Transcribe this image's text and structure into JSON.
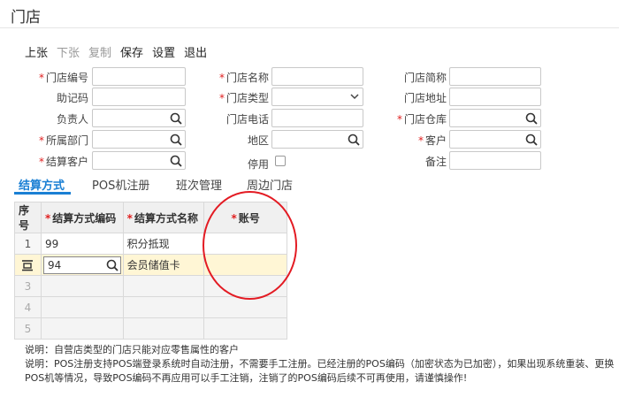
{
  "window": {
    "title": "门店"
  },
  "toolbar": {
    "items": [
      {
        "label": "上张",
        "enabled": true
      },
      {
        "label": "下张",
        "enabled": false
      },
      {
        "label": "复制",
        "enabled": false
      },
      {
        "label": "保存",
        "enabled": true
      },
      {
        "label": "设置",
        "enabled": true
      },
      {
        "label": "退出",
        "enabled": true
      }
    ]
  },
  "form": {
    "store_code": {
      "label": "门店编号",
      "required": true,
      "value": ""
    },
    "store_name": {
      "label": "门店名称",
      "required": true,
      "value": ""
    },
    "store_short": {
      "label": "门店简称",
      "required": false,
      "value": ""
    },
    "mnemonic": {
      "label": "助记码",
      "required": false,
      "value": ""
    },
    "store_type": {
      "label": "门店类型",
      "required": true,
      "value": ""
    },
    "store_address": {
      "label": "门店地址",
      "required": false,
      "value": ""
    },
    "manager": {
      "label": "负责人",
      "required": false,
      "value": ""
    },
    "store_phone": {
      "label": "门店电话",
      "required": false,
      "value": ""
    },
    "store_warehouse": {
      "label": "门店仓库",
      "required": true,
      "value": ""
    },
    "department": {
      "label": "所属部门",
      "required": true,
      "value": ""
    },
    "region": {
      "label": "地区",
      "required": false,
      "value": ""
    },
    "customer": {
      "label": "客户",
      "required": true,
      "value": ""
    },
    "settle_customer": {
      "label": "结算客户",
      "required": true,
      "value": ""
    },
    "disabled": {
      "label": "停用",
      "checked": false
    },
    "remark": {
      "label": "备注",
      "value": ""
    }
  },
  "tabs": [
    {
      "label": "结算方式",
      "active": true
    },
    {
      "label": "POS机注册",
      "active": false
    },
    {
      "label": "班次管理",
      "active": false
    },
    {
      "label": "周边门店",
      "active": false
    }
  ],
  "grid": {
    "headers": {
      "seq": "序号",
      "code": "结算方式编码",
      "name": "结算方式名称",
      "account": "账号"
    },
    "rows": [
      {
        "seq": "1",
        "code": "99",
        "name": "积分抵现",
        "account": ""
      },
      {
        "seq": "",
        "code": "94",
        "name": "会员储值卡",
        "account": ""
      },
      {
        "seq": "3",
        "code": "",
        "name": "",
        "account": ""
      },
      {
        "seq": "4",
        "code": "",
        "name": "",
        "account": ""
      },
      {
        "seq": "5",
        "code": "",
        "name": "",
        "account": ""
      }
    ]
  },
  "notes": {
    "line1": "说明：自营店类型的门店只能对应零售属性的客户",
    "line2": "说明：POS注册支持POS端登录系统时自动注册，不需要手工注册。已经注册的POS编码（加密状态为已加密），如果出现系统重装、更换POS机等情况，导致POS编码不再应用可以手工注销，注销了的POS编码后续不可再使用，请谨慎操作!"
  },
  "colors": {
    "accent": "#1a7fd4",
    "required": "#e02020",
    "annotation": "#e31b23",
    "selected_row": "#fff6d5"
  }
}
